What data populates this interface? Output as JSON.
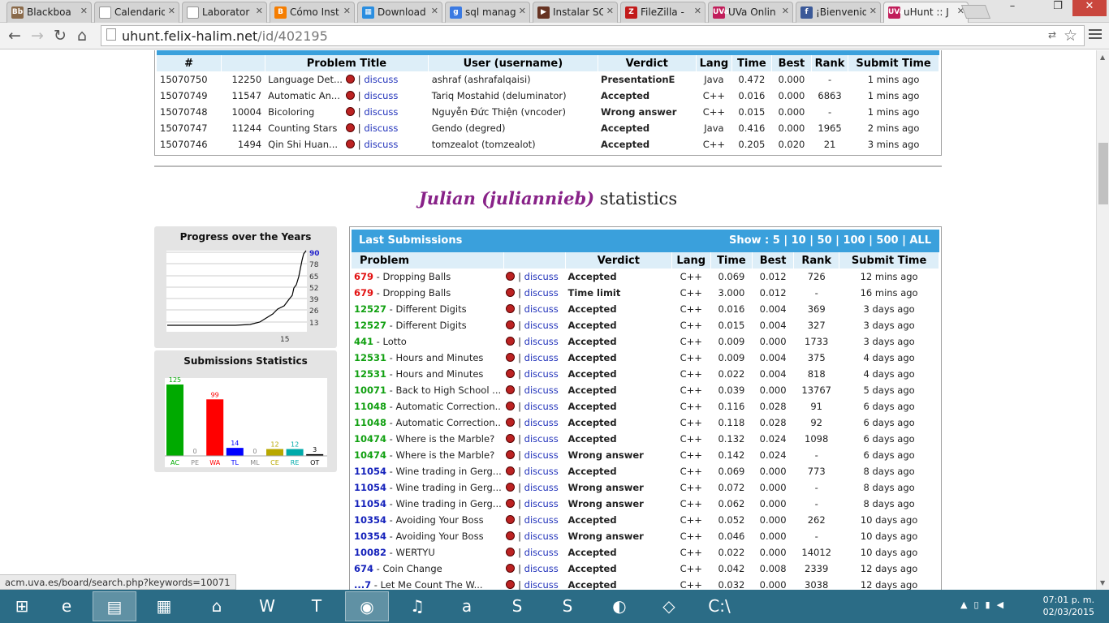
{
  "browser": {
    "tabs": [
      {
        "title": "Blackboa",
        "icon": "blackboard-icon",
        "color": "#8a6a4a",
        "glyph": "Bb"
      },
      {
        "title": "Calendario",
        "icon": "page-icon",
        "color": "#ffffff",
        "glyph": ""
      },
      {
        "title": "Laborator",
        "icon": "page-icon",
        "color": "#ffffff",
        "glyph": ""
      },
      {
        "title": "Cómo Inst",
        "icon": "blogger-icon",
        "color": "#f57d00",
        "glyph": "B"
      },
      {
        "title": "Download",
        "icon": "windows-icon",
        "color": "#2a8ee0",
        "glyph": "▦"
      },
      {
        "title": "sql manag",
        "icon": "google-icon",
        "color": "#3b7ae2",
        "glyph": "g"
      },
      {
        "title": "Instalar SQ",
        "icon": "video-icon",
        "color": "#663322",
        "glyph": "▶"
      },
      {
        "title": "FileZilla -",
        "icon": "filezilla-icon",
        "color": "#c21a1a",
        "glyph": "Z"
      },
      {
        "title": "UVa Onlin",
        "icon": "uva-icon",
        "color": "#c11d5a",
        "glyph": "UVa"
      },
      {
        "title": "¡Bienvenid",
        "icon": "facebook-icon",
        "color": "#3b5998",
        "glyph": "f"
      },
      {
        "title": "uHunt :: J",
        "icon": "uva-icon",
        "color": "#c11d5a",
        "glyph": "UVa"
      }
    ],
    "active_tab": 10,
    "url_host": "uhunt.felix-halim.net",
    "url_path": "/id/402195",
    "status_url": "acm.uva.es/board/search.php?keywords=10071"
  },
  "live": {
    "headers": [
      "#",
      "",
      "Problem Title",
      "User (username)",
      "Verdict",
      "Lang",
      "Time",
      "Best",
      "Rank",
      "Submit Time"
    ],
    "rows": [
      {
        "sid": "15070750",
        "pid": "12250",
        "title": "Language Det...",
        "discuss": "discuss",
        "user": "ashraf (ashrafalqaisi)",
        "verdict": "PresentationE",
        "vclass": "pres",
        "lang": "Java",
        "time": "0.472",
        "best": "0.000",
        "rank": "-",
        "ago": "1 mins ago"
      },
      {
        "sid": "15070749",
        "pid": "11547",
        "title": "Automatic An...",
        "discuss": "discuss",
        "user": "Tariq Mostahid (deluminator)",
        "verdict": "Accepted",
        "vclass": "acc",
        "lang": "C++",
        "time": "0.016",
        "best": "0.000",
        "rank": "6863",
        "ago": "1 mins ago"
      },
      {
        "sid": "15070748",
        "pid": "10004",
        "title": "Bicoloring",
        "discuss": "discuss",
        "user": "Nguyễn Đức Thiện (vncoder)",
        "verdict": "Wrong answer",
        "vclass": "wa",
        "lang": "C++",
        "time": "0.015",
        "best": "0.000",
        "rank": "-",
        "ago": "1 mins ago"
      },
      {
        "sid": "15070747",
        "pid": "11244",
        "title": "Counting Stars",
        "discuss": "discuss",
        "user": "Gendo (degred)",
        "verdict": "Accepted",
        "vclass": "acc",
        "lang": "Java",
        "time": "0.416",
        "best": "0.000",
        "rank": "1965",
        "ago": "2 mins ago"
      },
      {
        "sid": "15070746",
        "pid": "1494",
        "title": "Qin Shi Huan...",
        "discuss": "discuss",
        "user": "tomzealot (tomzealot)",
        "verdict": "Accepted",
        "vclass": "acc",
        "lang": "C++",
        "time": "0.205",
        "best": "0.020",
        "rank": "21",
        "ago": "3 mins ago"
      }
    ]
  },
  "stats_title": {
    "name": "Julian (juliannieb)",
    "suffix": " statistics"
  },
  "progress": {
    "title": "Progress over the Years",
    "y_ticks": [
      "90",
      "78",
      "65",
      "52",
      "39",
      "26",
      "13"
    ],
    "x_label": "15"
  },
  "chart_data": {
    "type": "bar",
    "title": "Submissions Statistics",
    "categories": [
      "AC",
      "PE",
      "WA",
      "TL",
      "ML",
      "CE",
      "RE",
      "OT"
    ],
    "values": [
      125,
      0,
      99,
      14,
      0,
      12,
      12,
      3
    ],
    "colors": [
      "#00aa00",
      "#888888",
      "#ff0000",
      "#0000ff",
      "#888888",
      "#b8a800",
      "#00aaaa",
      "#000000"
    ],
    "label_colors": [
      "#00aa00",
      "#888888",
      "#ff0000",
      "#0000ff",
      "#888888",
      "#b8a800",
      "#00aaaa",
      "#000000"
    ],
    "ylim": [
      0,
      125
    ]
  },
  "last": {
    "title": "Last Submissions",
    "show_label": "Show :",
    "show_options": [
      "5",
      "10",
      "50",
      "100",
      "500",
      "ALL"
    ],
    "headers": [
      "Problem",
      "",
      "Verdict",
      "Lang",
      "Time",
      "Best",
      "Rank",
      "Submit Time"
    ],
    "rows": [
      {
        "pid": "679",
        "pc": "pid-wa",
        "name": "Dropping Balls",
        "discuss": "discuss",
        "verdict": "Accepted",
        "vclass": "acc",
        "lang": "C++",
        "time": "0.069",
        "best": "0.012",
        "rank": "726",
        "ago": "12 mins ago"
      },
      {
        "pid": "679",
        "pc": "pid-wa",
        "name": "Dropping Balls",
        "discuss": "discuss",
        "verdict": "Time limit",
        "vclass": "tle",
        "lang": "C++",
        "time": "3.000",
        "best": "0.012",
        "rank": "-",
        "ago": "16 mins ago"
      },
      {
        "pid": "12527",
        "pc": "pid-ac",
        "name": "Different Digits",
        "discuss": "discuss",
        "verdict": "Accepted",
        "vclass": "acc",
        "lang": "C++",
        "time": "0.016",
        "best": "0.004",
        "rank": "369",
        "ago": "3 days ago"
      },
      {
        "pid": "12527",
        "pc": "pid-ac",
        "name": "Different Digits",
        "discuss": "discuss",
        "verdict": "Accepted",
        "vclass": "acc",
        "lang": "C++",
        "time": "0.015",
        "best": "0.004",
        "rank": "327",
        "ago": "3 days ago"
      },
      {
        "pid": "441",
        "pc": "pid-ac",
        "name": "Lotto",
        "discuss": "discuss",
        "verdict": "Accepted",
        "vclass": "acc",
        "lang": "C++",
        "time": "0.009",
        "best": "0.000",
        "rank": "1733",
        "ago": "3 days ago"
      },
      {
        "pid": "12531",
        "pc": "pid-ac",
        "name": "Hours and Minutes",
        "discuss": "discuss",
        "verdict": "Accepted",
        "vclass": "acc",
        "lang": "C++",
        "time": "0.009",
        "best": "0.004",
        "rank": "375",
        "ago": "4 days ago"
      },
      {
        "pid": "12531",
        "pc": "pid-ac",
        "name": "Hours and Minutes",
        "discuss": "discuss",
        "verdict": "Accepted",
        "vclass": "acc",
        "lang": "C++",
        "time": "0.022",
        "best": "0.004",
        "rank": "818",
        "ago": "4 days ago"
      },
      {
        "pid": "10071",
        "pc": "pid-ac",
        "name": "Back to High School ...",
        "discuss": "discuss",
        "verdict": "Accepted",
        "vclass": "acc",
        "lang": "C++",
        "time": "0.039",
        "best": "0.000",
        "rank": "13767",
        "ago": "5 days ago"
      },
      {
        "pid": "11048",
        "pc": "pid-ac",
        "name": "Automatic Correction...",
        "discuss": "discuss",
        "verdict": "Accepted",
        "vclass": "acc",
        "lang": "C++",
        "time": "0.116",
        "best": "0.028",
        "rank": "91",
        "ago": "6 days ago"
      },
      {
        "pid": "11048",
        "pc": "pid-ac",
        "name": "Automatic Correction...",
        "discuss": "discuss",
        "verdict": "Accepted",
        "vclass": "acc",
        "lang": "C++",
        "time": "0.118",
        "best": "0.028",
        "rank": "92",
        "ago": "6 days ago"
      },
      {
        "pid": "10474",
        "pc": "pid-ac",
        "name": "Where is the Marble?",
        "discuss": "discuss",
        "verdict": "Accepted",
        "vclass": "acc",
        "lang": "C++",
        "time": "0.132",
        "best": "0.024",
        "rank": "1098",
        "ago": "6 days ago"
      },
      {
        "pid": "10474",
        "pc": "pid-ac",
        "name": "Where is the Marble?",
        "discuss": "discuss",
        "verdict": "Wrong answer",
        "vclass": "wa",
        "lang": "C++",
        "time": "0.142",
        "best": "0.024",
        "rank": "-",
        "ago": "6 days ago"
      },
      {
        "pid": "11054",
        "pc": "pid-bl",
        "name": "Wine trading in Gerg...",
        "discuss": "discuss",
        "verdict": "Accepted",
        "vclass": "acc",
        "lang": "C++",
        "time": "0.069",
        "best": "0.000",
        "rank": "773",
        "ago": "8 days ago"
      },
      {
        "pid": "11054",
        "pc": "pid-bl",
        "name": "Wine trading in Gerg...",
        "discuss": "discuss",
        "verdict": "Wrong answer",
        "vclass": "wa",
        "lang": "C++",
        "time": "0.072",
        "best": "0.000",
        "rank": "-",
        "ago": "8 days ago"
      },
      {
        "pid": "11054",
        "pc": "pid-bl",
        "name": "Wine trading in Gerg...",
        "discuss": "discuss",
        "verdict": "Wrong answer",
        "vclass": "wa",
        "lang": "C++",
        "time": "0.062",
        "best": "0.000",
        "rank": "-",
        "ago": "8 days ago"
      },
      {
        "pid": "10354",
        "pc": "pid-bl",
        "name": "Avoiding Your Boss",
        "discuss": "discuss",
        "verdict": "Accepted",
        "vclass": "acc",
        "lang": "C++",
        "time": "0.052",
        "best": "0.000",
        "rank": "262",
        "ago": "10 days ago"
      },
      {
        "pid": "10354",
        "pc": "pid-bl",
        "name": "Avoiding Your Boss",
        "discuss": "discuss",
        "verdict": "Wrong answer",
        "vclass": "wa",
        "lang": "C++",
        "time": "0.046",
        "best": "0.000",
        "rank": "-",
        "ago": "10 days ago"
      },
      {
        "pid": "10082",
        "pc": "pid-bl",
        "name": "WERTYU",
        "discuss": "discuss",
        "verdict": "Accepted",
        "vclass": "acc",
        "lang": "C++",
        "time": "0.022",
        "best": "0.000",
        "rank": "14012",
        "ago": "10 days ago"
      },
      {
        "pid": "674",
        "pc": "pid-bl",
        "name": "Coin Change",
        "discuss": "discuss",
        "verdict": "Accepted",
        "vclass": "acc",
        "lang": "C++",
        "time": "0.042",
        "best": "0.008",
        "rank": "2339",
        "ago": "12 days ago"
      },
      {
        "pid": "...7",
        "pc": "pid-bl",
        "name": "Let Me Count The W...",
        "discuss": "discuss",
        "verdict": "Accepted",
        "vclass": "acc",
        "lang": "C++",
        "time": "0.032",
        "best": "0.000",
        "rank": "3038",
        "ago": "12 days ago"
      }
    ]
  },
  "taskbar": {
    "apps": [
      {
        "name": "start-button",
        "glyph": "⊞"
      },
      {
        "name": "internet-explorer-icon",
        "glyph": "e"
      },
      {
        "name": "file-explorer-icon",
        "glyph": "▤"
      },
      {
        "name": "store-icon",
        "glyph": "▦"
      },
      {
        "name": "home-icon",
        "glyph": "⌂"
      },
      {
        "name": "webstorm-icon",
        "glyph": "W"
      },
      {
        "name": "typora-icon",
        "glyph": "T"
      },
      {
        "name": "chrome-icon",
        "glyph": "◉"
      },
      {
        "name": "itunes-icon",
        "glyph": "♫"
      },
      {
        "name": "amazon-icon",
        "glyph": "a"
      },
      {
        "name": "sublime-s-icon",
        "glyph": "S"
      },
      {
        "name": "sublime-text-icon",
        "glyph": "S"
      },
      {
        "name": "eclipse-icon",
        "glyph": "◐"
      },
      {
        "name": "virtualbox-icon",
        "glyph": "◇"
      },
      {
        "name": "cmd-icon",
        "glyph": "C:\\"
      }
    ],
    "time": "07:01 p. m.",
    "date": "02/03/2015"
  }
}
